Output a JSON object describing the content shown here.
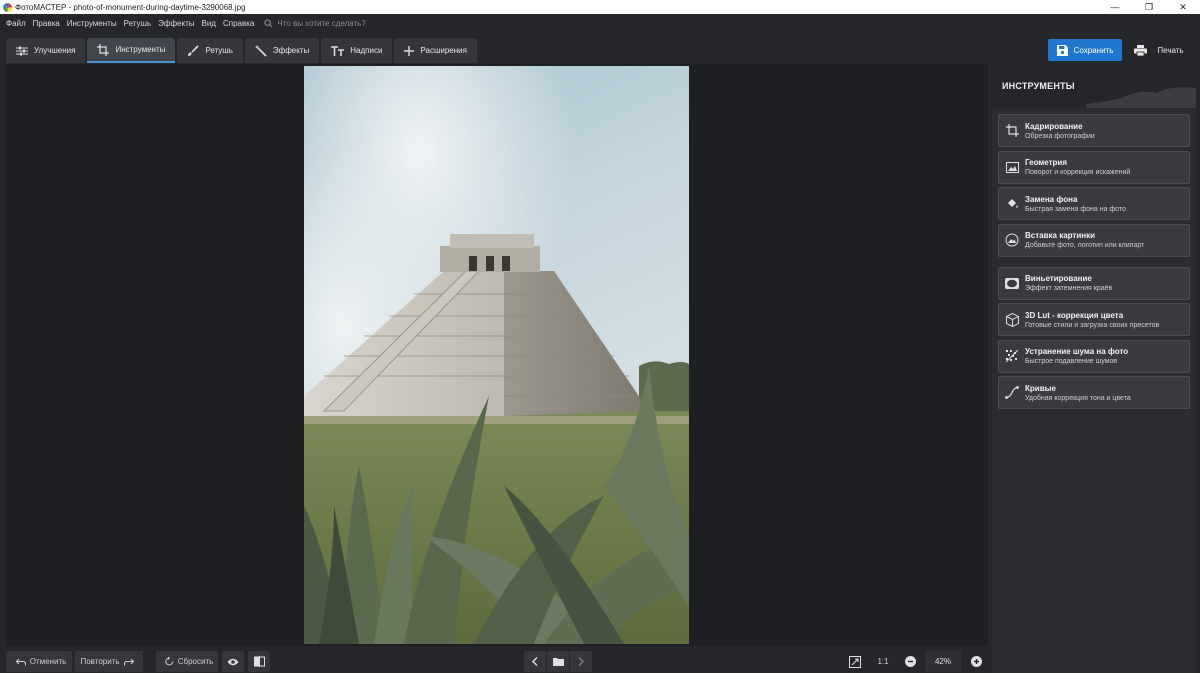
{
  "window": {
    "title": "ФотоМАСТЕР - photo-of-monument-during-daytime-3290068.jpg"
  },
  "menu": {
    "items": [
      "Файл",
      "Правка",
      "Инструменты",
      "Ретушь",
      "Эффекты",
      "Вид",
      "Справка"
    ],
    "search_placeholder": "Что вы хотите сделать?"
  },
  "tabs": [
    {
      "label": "Улучшения",
      "icon": "sliders-icon",
      "active": false
    },
    {
      "label": "Инструменты",
      "icon": "crop-icon",
      "active": true
    },
    {
      "label": "Ретушь",
      "icon": "brush-icon",
      "active": false
    },
    {
      "label": "Эффекты",
      "icon": "magic-wand-icon",
      "active": false
    },
    {
      "label": "Надписи",
      "icon": "text-icon",
      "active": false
    },
    {
      "label": "Расширения",
      "icon": "plus-icon",
      "active": false
    }
  ],
  "actions": {
    "save_label": "Сохранить",
    "print_label": "Печать"
  },
  "panel": {
    "title": "ИНСТРУМЕНТЫ",
    "tools": [
      {
        "name": "Кадрирование",
        "desc": "Обрезка фотографии",
        "icon": "crop-icon"
      },
      {
        "name": "Геометрия",
        "desc": "Поворот и коррекция искажений",
        "icon": "geometry-icon"
      },
      {
        "name": "Замена фона",
        "desc": "Быстрая замена фона на фото",
        "icon": "paint-bucket-icon"
      },
      {
        "name": "Вставка картинки",
        "desc": "Добавьте фото, логотип или клипарт",
        "icon": "insert-image-icon"
      },
      {
        "name": "Виньетирование",
        "desc": "Эффект затемнения краёв",
        "icon": "vignette-icon"
      },
      {
        "name": "3D Lut - коррекция цвета",
        "desc": "Готовые стили и загрузка своих пресетов",
        "icon": "cube-icon"
      },
      {
        "name": "Устранение шума на фото",
        "desc": "Быстрое подавление шумов",
        "icon": "noise-icon"
      },
      {
        "name": "Кривые",
        "desc": "Удобная коррекция тона и цвета",
        "icon": "curves-icon"
      }
    ]
  },
  "bottom": {
    "undo_label": "Отменить",
    "redo_label": "Повторить",
    "reset_label": "Сбросить",
    "ratio_label": "1:1",
    "zoom_value": "42%"
  },
  "colors": {
    "accent": "#1f77d0",
    "background": "#26272b",
    "canvas": "#1e1f22",
    "panel": "#2b2c30"
  }
}
